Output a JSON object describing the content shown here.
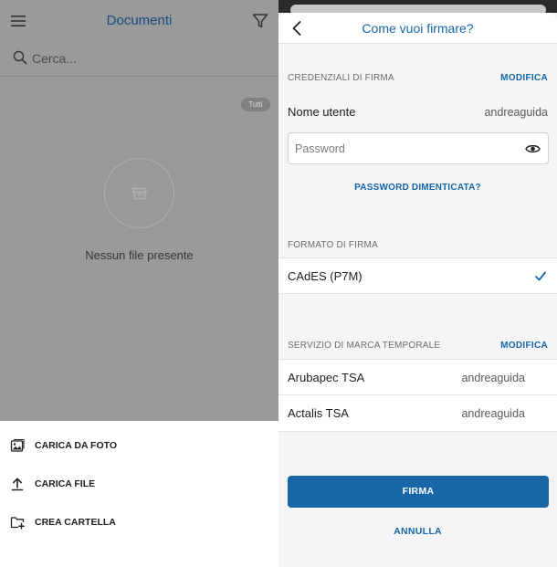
{
  "left_panel": {
    "header": {
      "title": "Documenti",
      "menu_icon": "hamburger-menu-icon",
      "filter_icon": "filter-funnel-icon"
    },
    "search": {
      "placeholder": "Cerca...",
      "icon": "search-icon"
    },
    "filter_badge": "Tutti",
    "empty_state": {
      "icon": "archive-box-icon",
      "text": "Nessun file presente"
    },
    "bottom_sheet": {
      "items": [
        {
          "label": "CARICA DA FOTO",
          "icon": "image-gallery-icon"
        },
        {
          "label": "CARICA FILE",
          "icon": "upload-icon"
        },
        {
          "label": "CREA CARTELLA",
          "icon": "folder-plus-icon"
        }
      ]
    }
  },
  "right_panel": {
    "header": {
      "title": "Come vuoi firmare?",
      "back_icon": "chevron-left-icon"
    },
    "credentials": {
      "section_label": "CREDENZIALI DI FIRMA",
      "edit_label": "MODIFICA",
      "username_label": "Nome utente",
      "username_value": "andreaguida",
      "password_placeholder": "Password",
      "password_icon": "eye-icon",
      "forgot_label": "PASSWORD DIMENTICATA?"
    },
    "format": {
      "section_label": "FORMATO DI FIRMA",
      "selected": "CAdES (P7M)",
      "check_icon": "checkmark-icon"
    },
    "timestamp": {
      "section_label": "SERVIZIO DI MARCA TEMPORALE",
      "edit_label": "MODIFICA",
      "services": [
        {
          "name": "Arubapec TSA",
          "user": "andreaguida"
        },
        {
          "name": "Actalis TSA",
          "user": "andreaguida"
        }
      ]
    },
    "sign_button": "FIRMA",
    "cancel_button": "ANNULLA"
  },
  "colors": {
    "accent_blue": "#1565a8",
    "button_blue": "#1866a6",
    "overlay_gray": "#9a9a9a",
    "panel_bg": "#f5f5f7"
  }
}
